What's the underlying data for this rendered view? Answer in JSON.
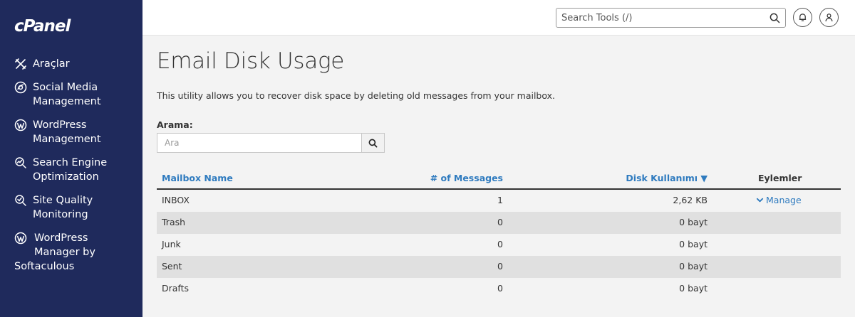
{
  "brand": {
    "logo_text": "cPanel"
  },
  "sidebar": {
    "items": [
      {
        "label": "Araçlar",
        "icon": "tools-icon"
      },
      {
        "label_line1": "Social Media",
        "label_line2": "Management",
        "icon": "social-media-icon"
      },
      {
        "label_line1": "WordPress",
        "label_line2": "Management",
        "icon": "wordpress-icon"
      },
      {
        "label_line1": "Search Engine",
        "label_line2": "Optimization",
        "icon": "seo-icon"
      },
      {
        "label_line1": "Site Quality",
        "label_line2": "Monitoring",
        "icon": "site-quality-icon"
      },
      {
        "label_line1": "WordPress",
        "label_line2": "Manager by",
        "label_line3": "Softaculous",
        "icon": "wordpress-icon"
      }
    ]
  },
  "topbar": {
    "search_placeholder": "Search Tools (/)"
  },
  "page": {
    "title": "Email Disk Usage",
    "description": "This utility allows you to recover disk space by deleting old messages from your mailbox.",
    "filter_label": "Arama:",
    "filter_placeholder": "Ara"
  },
  "table": {
    "headers": {
      "mailbox": "Mailbox Name",
      "messages": "# of Messages",
      "disk": "Disk Kullanımı ▼",
      "actions": "Eylemler"
    },
    "rows": [
      {
        "name": "INBOX",
        "messages": "1",
        "disk": "2,62 KB",
        "action": "Manage"
      },
      {
        "name": "Trash",
        "messages": "0",
        "disk": "0 bayt"
      },
      {
        "name": "Junk",
        "messages": "0",
        "disk": "0 bayt"
      },
      {
        "name": "Sent",
        "messages": "0",
        "disk": "0 bayt"
      },
      {
        "name": "Drafts",
        "messages": "0",
        "disk": "0 bayt"
      }
    ]
  },
  "colors": {
    "sidebar_bg": "#1f2a5c",
    "link": "#2f7bbf",
    "row_alt": "#e0e0e0"
  }
}
